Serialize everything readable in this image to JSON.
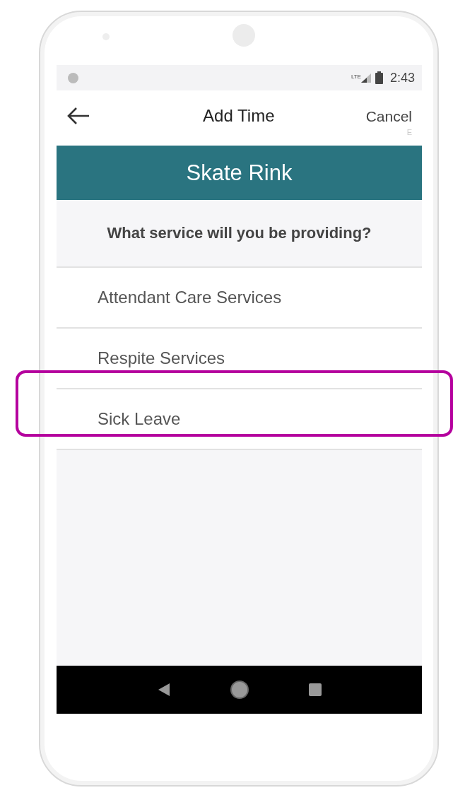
{
  "status_bar": {
    "time": "2:43",
    "network": "LTE"
  },
  "header": {
    "title": "Add Time",
    "action": "Cancel",
    "hint": "E"
  },
  "banner": {
    "title": "Skate Rink"
  },
  "question": "What service will you be providing?",
  "services": [
    {
      "label": "Attendant Care Services",
      "highlighted": false
    },
    {
      "label": "Respite Services",
      "highlighted": false
    },
    {
      "label": "Sick Leave",
      "highlighted": true
    }
  ]
}
